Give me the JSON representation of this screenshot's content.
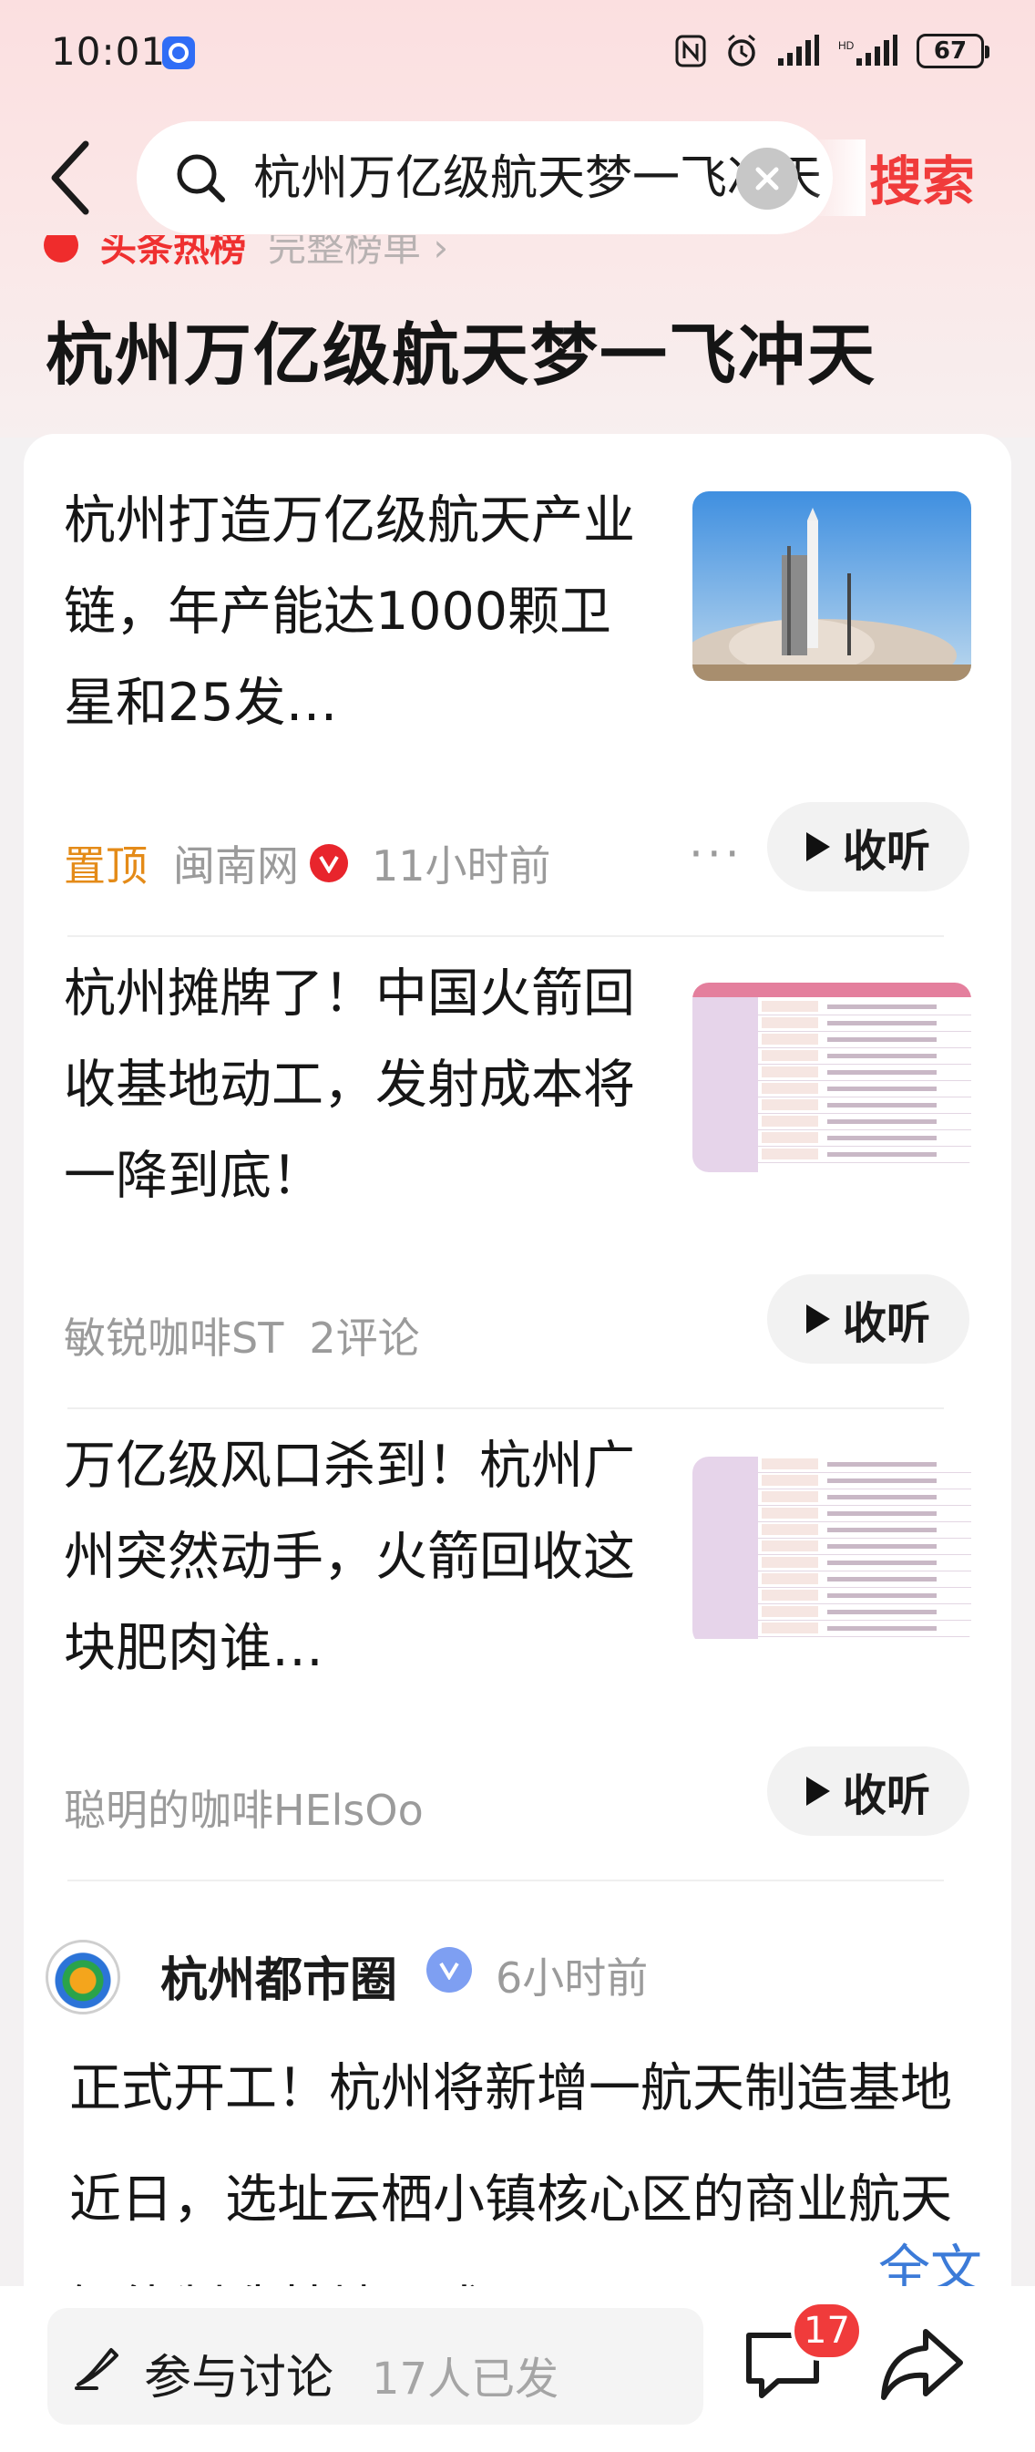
{
  "status_bar": {
    "time": "10:01",
    "battery": "67"
  },
  "search": {
    "query": "杭州万亿级航天梦一飞冲天",
    "button_label": "搜索"
  },
  "header": {
    "rank_label": "头条热榜",
    "rank_sub": "完整榜单 ›",
    "title": "杭州万亿级航天梦一飞冲天"
  },
  "articles": [
    {
      "title": "杭州打造万亿级航天产业链，年产能达1000颗卫星和25发…",
      "pinned_label": "置顶",
      "source": "闽南网",
      "time": "11小时前",
      "more": "···",
      "listen_label": "收听",
      "thumb": "rocket-launch-photo"
    },
    {
      "title": "杭州摊牌了！中国火箭回收基地动工，发射成本将一降到底！",
      "source": "敏锐咖啡ST",
      "comments": "2评论",
      "listen_label": "收听",
      "thumb": "aerospace-table-image"
    },
    {
      "title": "万亿级风口杀到！杭州广州突然动手，火箭回收这块肥肉谁…",
      "source": "聪明的咖啡HElsOo",
      "listen_label": "收听",
      "thumb": "aerospace-table-image"
    }
  ],
  "post": {
    "author": "杭州都市圈",
    "time": "6小时前",
    "body": "正式开工！杭州将新增一航天制造基地近日，选址云栖小镇核心区的商业航天智能制造基地正式",
    "full_label": "全文"
  },
  "bottom_bar": {
    "discuss_label": "参与讨论",
    "discuss_count": "17人已发",
    "comment_badge": "17"
  },
  "colors": {
    "accent_red": "#f03b3b",
    "pin_orange": "#e48b18",
    "link_blue": "#3c7bd8"
  }
}
